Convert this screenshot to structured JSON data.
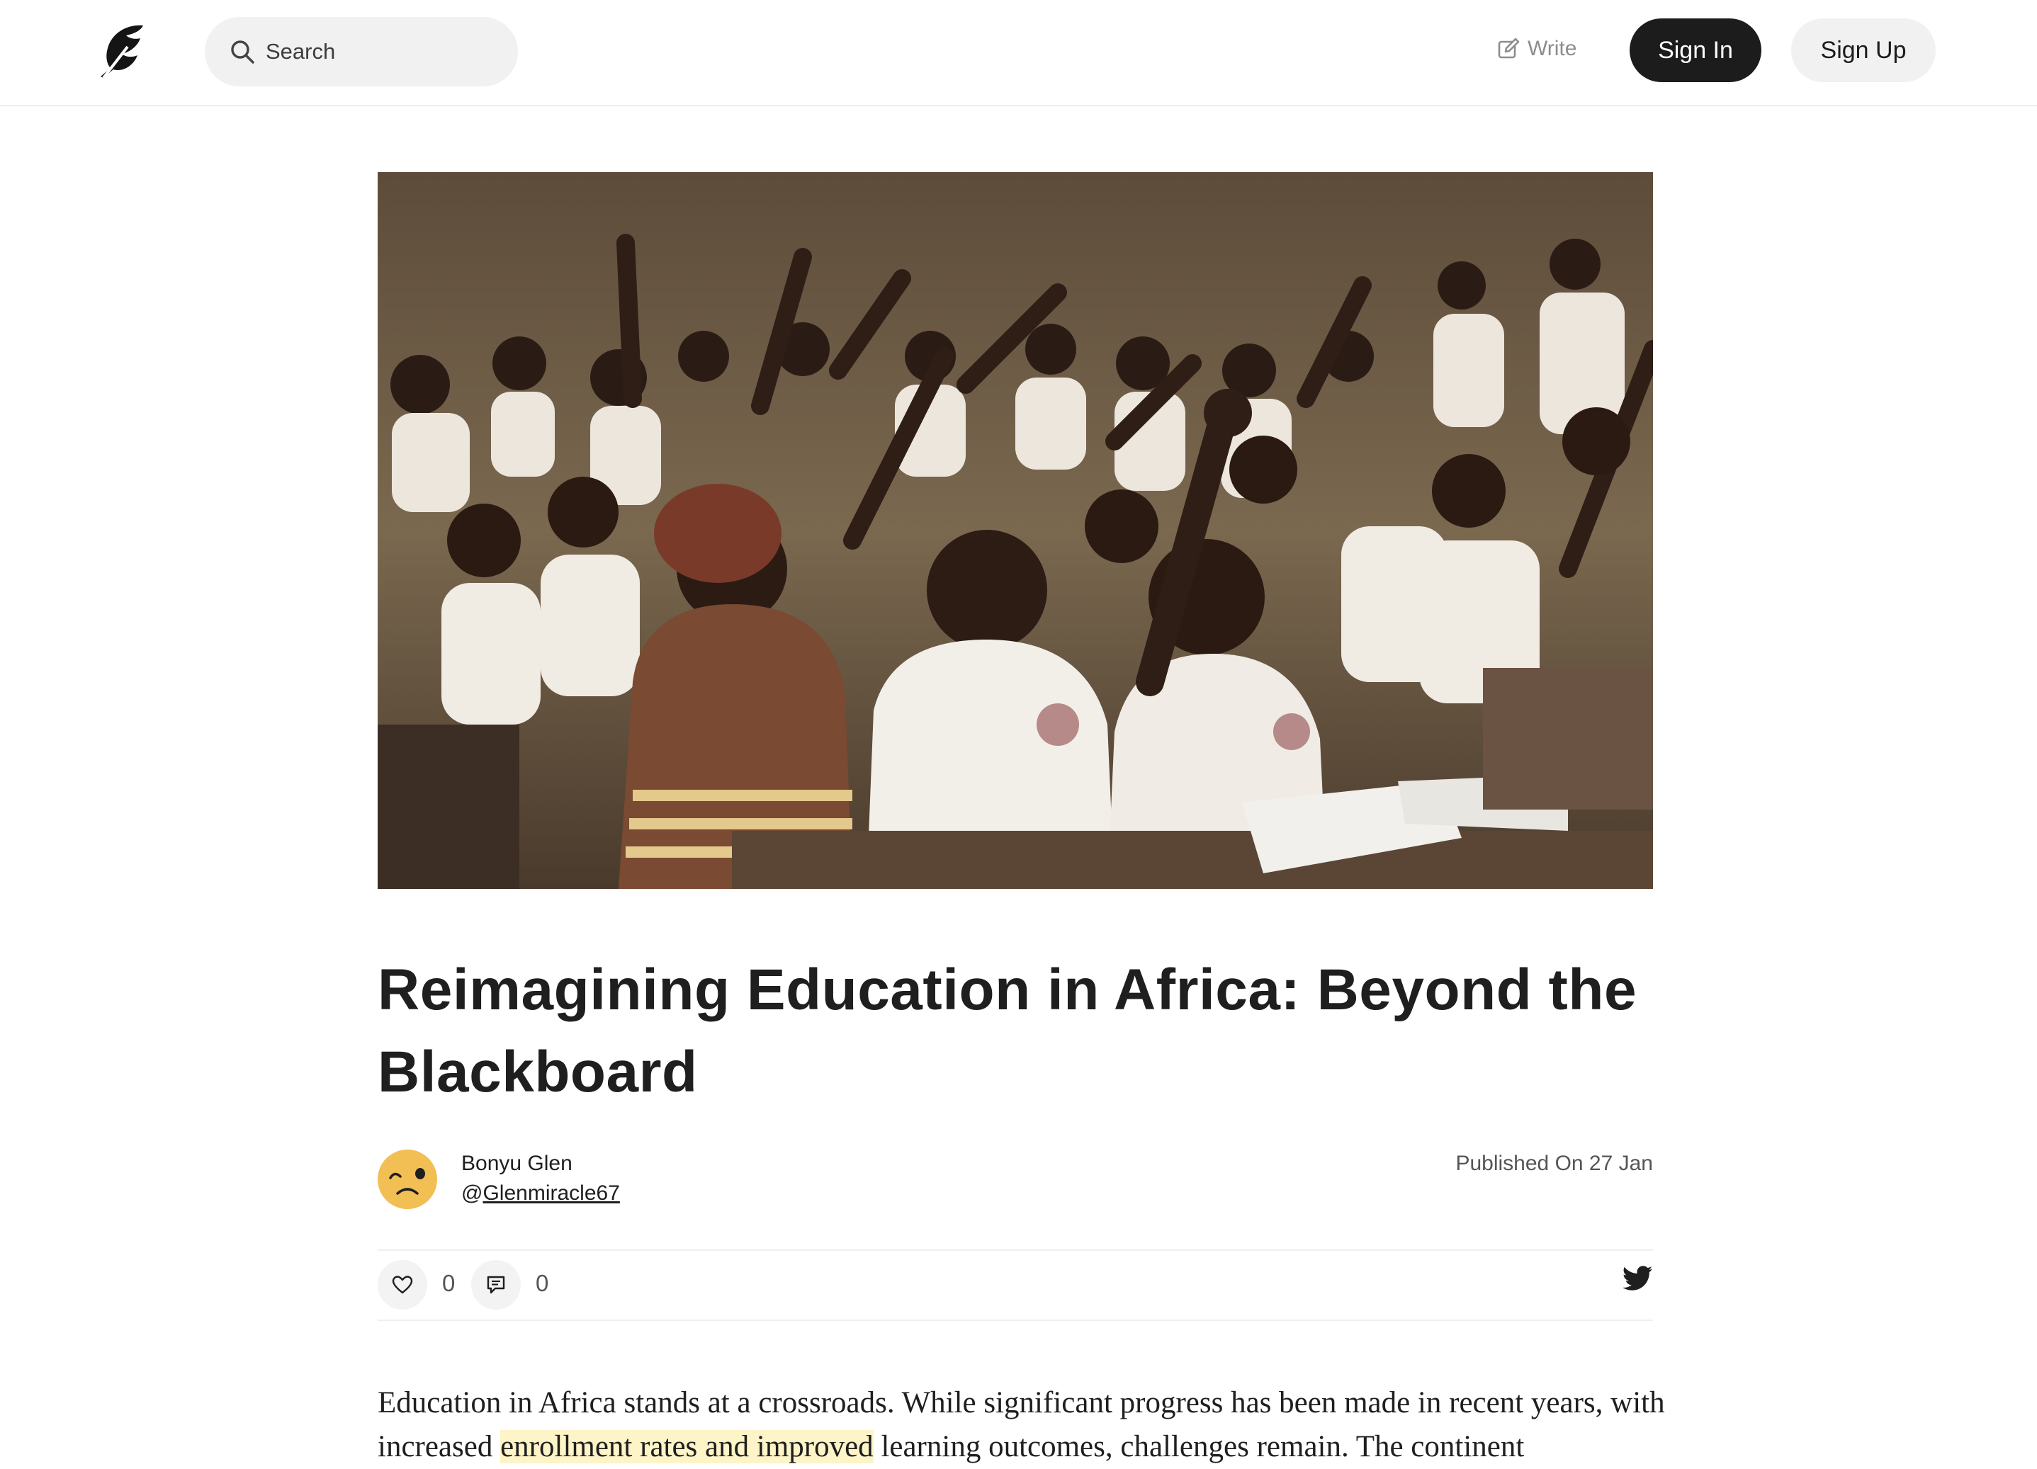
{
  "header": {
    "search_placeholder": "Search",
    "write_label": "Write",
    "signin_label": "Sign In",
    "signup_label": "Sign Up"
  },
  "article": {
    "title": "Reimagining Education in Africa: Beyond the Blackboard",
    "author_name": "Bonyu Glen",
    "author_handle_prefix": "@",
    "author_handle": "Glenmiracle67",
    "published": "Published On 27 Jan",
    "likes": "0",
    "comments": "0",
    "body_start": "Education in Africa stands at a crossroads. While significant progress has been made in recent years, with increased ",
    "body_highlight": "enrollment rates and improved",
    "body_end": " learning outcomes, challenges remain. The continent"
  },
  "colors": {
    "primary_button": "#1c1c1c",
    "secondary_button": "#f1f1f1",
    "highlight": "#fdf4c7",
    "avatar": "#f2bf55"
  },
  "icons": [
    "quill-logo-icon",
    "search-icon",
    "edit-icon",
    "heart-icon",
    "comment-icon",
    "twitter-icon"
  ]
}
